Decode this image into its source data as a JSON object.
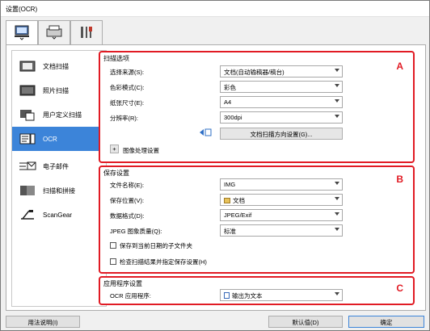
{
  "window": {
    "title": "设置(OCR)"
  },
  "tabs": [
    {
      "name": "scan-from-computer-icon"
    },
    {
      "name": "scan-from-panel-icon"
    },
    {
      "name": "general-settings-icon"
    }
  ],
  "sidebar": {
    "items": [
      {
        "label": "文档扫描",
        "icon": "document-scan-icon",
        "selected": false
      },
      {
        "label": "照片扫描",
        "icon": "photo-scan-icon",
        "selected": false
      },
      {
        "label": "用户定义扫描",
        "icon": "custom-scan-icon",
        "selected": false
      },
      {
        "label": "OCR",
        "icon": "ocr-icon",
        "selected": true
      },
      {
        "label": "电子邮件",
        "icon": "email-icon",
        "selected": false
      },
      {
        "label": "扫描和拼接",
        "icon": "stitch-icon",
        "selected": false
      },
      {
        "label": "ScanGear",
        "icon": "scangear-icon",
        "selected": false
      }
    ]
  },
  "scan_options": {
    "header": "扫描选项",
    "letter": "A",
    "source_label": "选择来源(S):",
    "source_value": "文档(自动输稿器/稿台)",
    "color_label": "色彩模式(C):",
    "color_value": "彩色",
    "paper_label": "纸张尺寸(E):",
    "paper_value": "A4",
    "res_label": "分辨率(R):",
    "res_value": "300dpi",
    "orientation_button": "文档扫描方向设置(G)...",
    "image_processing": "图像处理设置",
    "expand_symbol": "+"
  },
  "save_settings": {
    "header": "保存设置",
    "letter": "B",
    "filename_label": "文件名称(E):",
    "filename_value": "IMG",
    "saveto_label": "保存位置(V):",
    "saveto_value": "文档",
    "format_label": "数据格式(D):",
    "format_value": "JPEG/Exif",
    "quality_label": "JPEG 图象质量(Q):",
    "quality_value": "标准",
    "subfolder_label": "保存到当前日期的子文件夹",
    "check_label": "检查扫描结果并指定保存设置(H)"
  },
  "app_settings": {
    "header": "应用程序设置",
    "letter": "C",
    "ocr_label": "OCR 应用程序:",
    "ocr_value": "输出为文本"
  },
  "footer": {
    "help": "用法说明(I)",
    "defaults": "默认值(D)",
    "ok": "确定"
  },
  "colors": {
    "highlight": "#e11b24",
    "selected": "#3c84d9"
  }
}
